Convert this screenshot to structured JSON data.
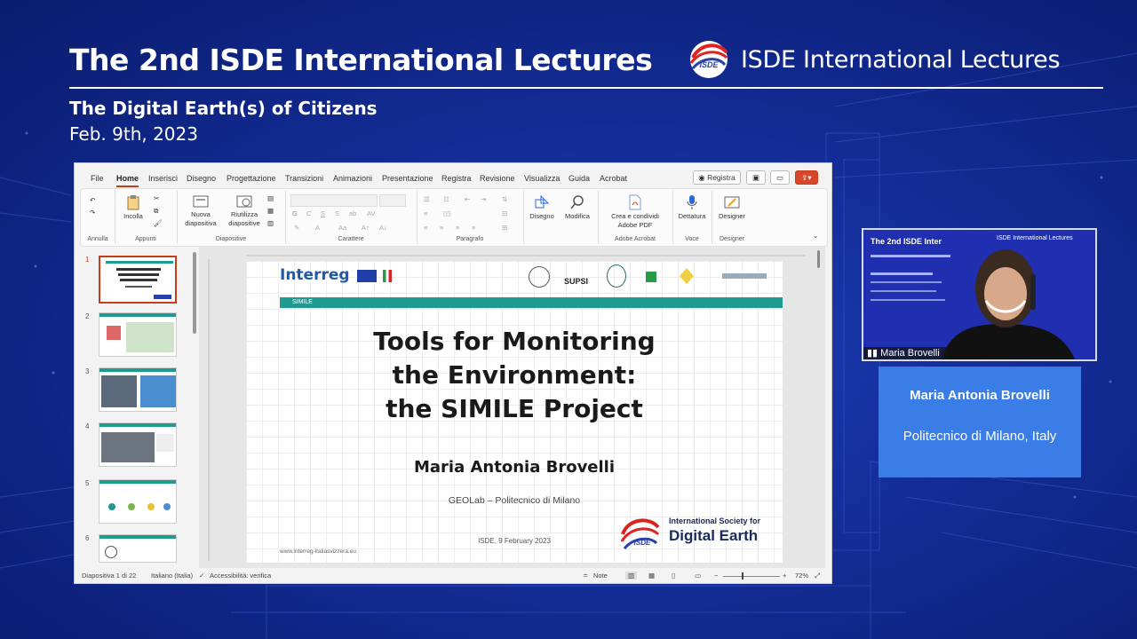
{
  "header": {
    "title": "The 2nd ISDE International Lectures",
    "subtitle": "The Digital Earth(s) of Citizens",
    "date": "Feb. 9th, 2023",
    "brand_text": "ISDE International Lectures",
    "brand_logo_text": "ISDE"
  },
  "ppt": {
    "menu": [
      "File",
      "Home",
      "Inserisci",
      "Disegno",
      "Progettazione",
      "Transizioni",
      "Animazioni",
      "Presentazione",
      "Registra",
      "Revisione",
      "Visualizza",
      "Guida",
      "Acrobat"
    ],
    "active_tab": "Home",
    "record_label": "Registra",
    "ribbon": {
      "incolla": "Incolla",
      "nuova_1": "Nuova",
      "nuova_2": "diapositiva",
      "riutilizza_1": "Riutilizza",
      "riutilizza_2": "diapositive",
      "disegno": "Disegno",
      "modifica": "Modifica",
      "crea_1": "Crea e condividi",
      "crea_2": "Adobe PDF",
      "dettatura": "Dettatura",
      "designer": "Designer",
      "groups": {
        "annulla": "Annulla",
        "appunti": "Appunti",
        "diapositive": "Diapositive",
        "carattere": "Carattere",
        "paragrafo": "Paragrafo",
        "adobe": "Adobe Acrobat",
        "voce": "Voce",
        "designer": "Designer"
      }
    },
    "thumb_numbers": [
      "1",
      "2",
      "3",
      "4",
      "5",
      "6"
    ],
    "slide": {
      "interreg": "Interreg",
      "simile": "SIMILE",
      "supsi": "SUPSI",
      "title_1": "Tools for Monitoring",
      "title_2": "the Environment:",
      "title_3": "the SIMILE Project",
      "author": "Maria Antonia Brovelli",
      "affiliation": "GEOLab – Politecnico di Milano",
      "date": "ISDE, 9 February 2023",
      "url": "www.interreg-italiasvizzera.eu",
      "isde_line1": "International Society for",
      "isde_line2": "Digital Earth",
      "isde_logo": "ISDE"
    },
    "status": {
      "slide_count": "Diapositiva 1 di 22",
      "language": "Italiano (Italia)",
      "accessibility": "Accessibilità: verifica",
      "notes": "Note",
      "zoom": "72%"
    }
  },
  "video": {
    "participant": "Maria Brovelli",
    "screen_title": "The 2nd ISDE Inter",
    "screen_brand": "ISDE International Lectures"
  },
  "speaker": {
    "name": "Maria Antonia Brovelli",
    "affiliation": "Politecnico di Milano, Italy"
  },
  "colors": {
    "background": "#132c96",
    "accent_ppt": "#c43e1c",
    "speaker_box": "#3a7de6",
    "simile_bar": "#1e9a8e"
  }
}
